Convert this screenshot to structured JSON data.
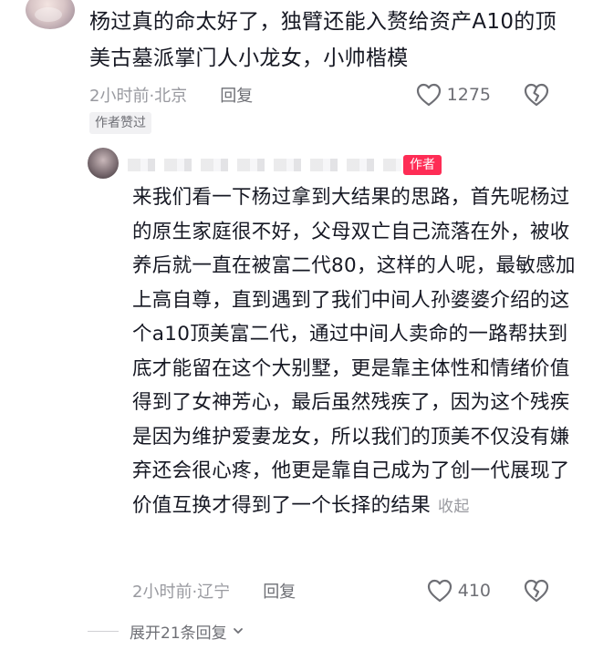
{
  "main_comment": {
    "text": "杨过真的命太好了，独臂还能入赘给资产A10的顶美古墓派掌门人小龙女，小帅楷模",
    "time": "2小时前·北京",
    "reply_label": "回复",
    "like_count": "1275",
    "author_liked_label": "作者赞过"
  },
  "reply_comment": {
    "author_tag": "作者",
    "text": "来我们看一下杨过拿到大结果的思路，首先呢杨过的原生家庭很不好，父母双亡自己流落在外，被收养后就一直在被富二代80，这样的人呢，最敏感加上高自尊，直到遇到了我们中间人孙婆婆介绍的这个a10顶美富二代，通过中间人卖命的一路帮扶到底才能留在这个大别墅，更是靠主体性和情绪价值得到了女神芳心，最后虽然残疾了，因为这个残疾是因为维护爱妻龙女，所以我们的顶美不仅没有嫌弃还会很心疼，他更是靠自己成为了创一代展现了价值互换才得到了一个长择的结果",
    "collapse_label": "收起",
    "time": "2小时前·辽宁",
    "reply_label": "回复",
    "like_count": "410"
  },
  "expand_label": "展开21条回复",
  "icons": {
    "like": "heart-outline-icon",
    "dislike": "broken-heart-icon",
    "expand": "chevron-down-icon"
  },
  "colors": {
    "author_tag_bg": "#fe2c55",
    "meta_gray": "#999aa0",
    "text_dark": "#161823"
  }
}
